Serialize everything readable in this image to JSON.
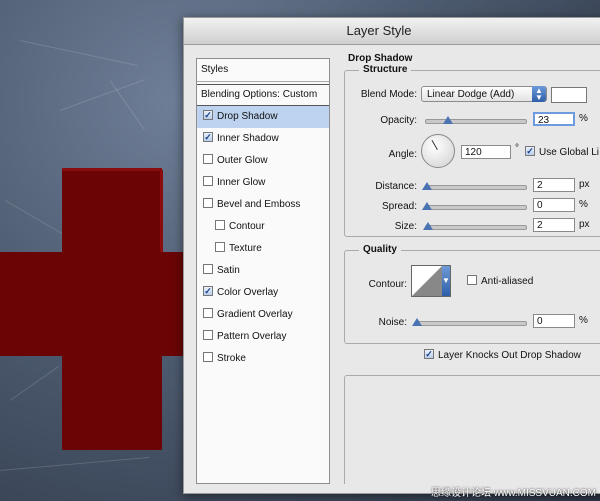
{
  "dialog": {
    "title": "Layer Style"
  },
  "styles_panel": {
    "header": "Styles",
    "blending_options": "Blending Options: Custom",
    "items": [
      {
        "label": "Drop Shadow",
        "checked": true,
        "active": true,
        "indent": false
      },
      {
        "label": "Inner Shadow",
        "checked": true,
        "active": false,
        "indent": false
      },
      {
        "label": "Outer Glow",
        "checked": false,
        "active": false,
        "indent": false
      },
      {
        "label": "Inner Glow",
        "checked": false,
        "active": false,
        "indent": false
      },
      {
        "label": "Bevel and Emboss",
        "checked": false,
        "active": false,
        "indent": false
      },
      {
        "label": "Contour",
        "checked": false,
        "active": false,
        "indent": true
      },
      {
        "label": "Texture",
        "checked": false,
        "active": false,
        "indent": true
      },
      {
        "label": "Satin",
        "checked": false,
        "active": false,
        "indent": false
      },
      {
        "label": "Color Overlay",
        "checked": true,
        "active": false,
        "indent": false
      },
      {
        "label": "Gradient Overlay",
        "checked": false,
        "active": false,
        "indent": false
      },
      {
        "label": "Pattern Overlay",
        "checked": false,
        "active": false,
        "indent": false
      },
      {
        "label": "Stroke",
        "checked": false,
        "active": false,
        "indent": false
      }
    ]
  },
  "drop_shadow": {
    "section_title": "Drop Shadow",
    "structure_title": "Structure",
    "blend_mode_label": "Blend Mode:",
    "blend_mode_value": "Linear Dodge (Add)",
    "opacity_label": "Opacity:",
    "opacity_value": "23",
    "opacity_unit": "%",
    "opacity_fraction": 0.23,
    "angle_label": "Angle:",
    "angle_value": "120",
    "angle_unit": "°",
    "use_global_light_label": "Use Global Li",
    "use_global_light_checked": true,
    "distance_label": "Distance:",
    "distance_value": "2",
    "distance_unit": "px",
    "spread_label": "Spread:",
    "spread_value": "0",
    "spread_unit": "%",
    "size_label": "Size:",
    "size_value": "2",
    "size_unit": "px",
    "quality_title": "Quality",
    "contour_label": "Contour:",
    "anti_aliased_label": "Anti-aliased",
    "anti_aliased_checked": false,
    "noise_label": "Noise:",
    "noise_value": "0",
    "noise_unit": "%",
    "knockout_label": "Layer Knocks Out Drop Shadow",
    "knockout_checked": true
  },
  "colors": {
    "shape_red": "#6b0505",
    "active_row": "#bdd3f0",
    "accent_blue": "#4a73b3"
  },
  "watermark": "思缘设计论坛 www.MISSVUAN.COM"
}
